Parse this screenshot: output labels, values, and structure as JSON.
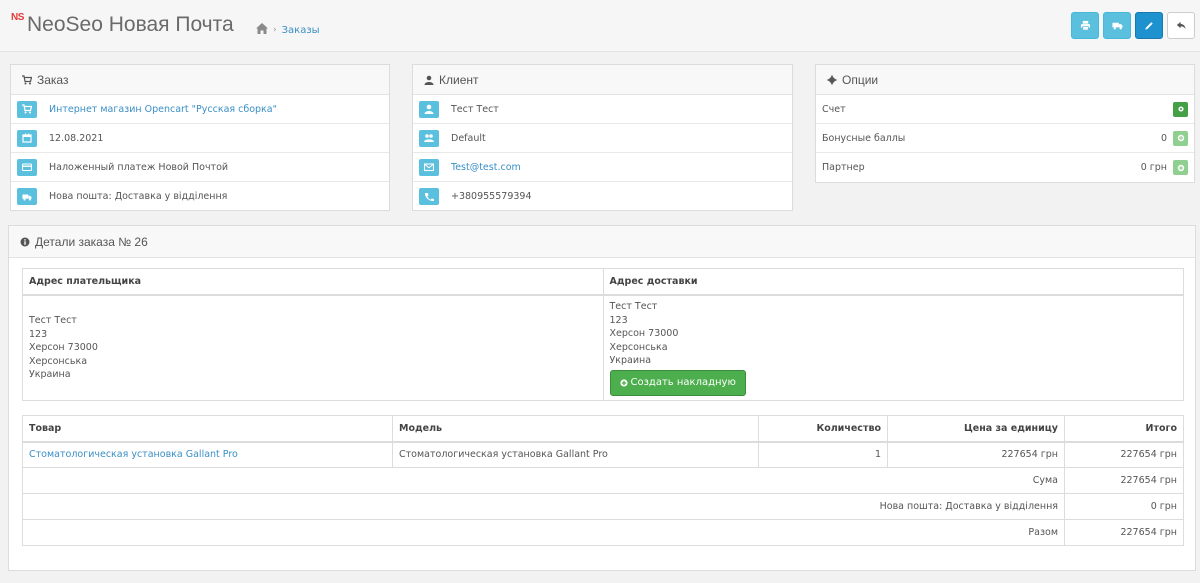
{
  "header": {
    "logo": "NS",
    "title": "NeoSeo Новая Почта",
    "breadcrumb": "Заказы"
  },
  "toolbar": {
    "buttons": [
      "print-icon",
      "truck-icon",
      "pencil-icon",
      "reply-icon"
    ]
  },
  "order_panel": {
    "heading": "Заказ",
    "store": "Интернет магазин Opencart \"Русская сборка\"",
    "date": "12.08.2021",
    "payment": "Наложенный платеж Новой Почтой",
    "shipping": "Нова пошта: Доставка у відділення"
  },
  "customer_panel": {
    "heading": "Клиент",
    "name": "Тест Тест",
    "group": "Default",
    "email": "Test@test.com",
    "phone": "+380955579394"
  },
  "options_panel": {
    "heading": "Опции",
    "invoice_label": "Счет",
    "bonus_label": "Бонусные баллы",
    "bonus_value": "0",
    "partner_label": "Партнер",
    "partner_value": "0 грн"
  },
  "details": {
    "heading": "Детали заказа № 26",
    "payment_address_header": "Адрес плательщика",
    "shipping_address_header": "Адрес доставки",
    "payment_address": [
      "Тест Тест",
      "123",
      "Херсон 73000",
      "Херсонська",
      "Украина"
    ],
    "shipping_address": [
      "Тест Тест",
      "123",
      "Херсон 73000",
      "Херсонська",
      "Украина"
    ],
    "create_invoice_label": "Создать накладную"
  },
  "products": {
    "headers": {
      "product": "Товар",
      "model": "Модель",
      "quantity": "Количество",
      "unit_price": "Цена за единицу",
      "total": "Итого"
    },
    "rows": [
      {
        "product": "Стоматологическая установка Gallant Pro",
        "model": "Стоматологическая установка Gallant Pro",
        "quantity": "1",
        "unit_price": "227654 грн",
        "total": "227654 грн"
      }
    ],
    "totals": [
      {
        "label": "Сума",
        "value": "227654 грн"
      },
      {
        "label": "Нова пошта: Доставка у відділення",
        "value": "0 грн"
      },
      {
        "label": "Разом",
        "value": "227654 грн"
      }
    ]
  },
  "colors": {
    "info": "#5bc0de",
    "primary": "#1e91cf",
    "success": "#4cae4c",
    "link": "#3a8fc6"
  }
}
